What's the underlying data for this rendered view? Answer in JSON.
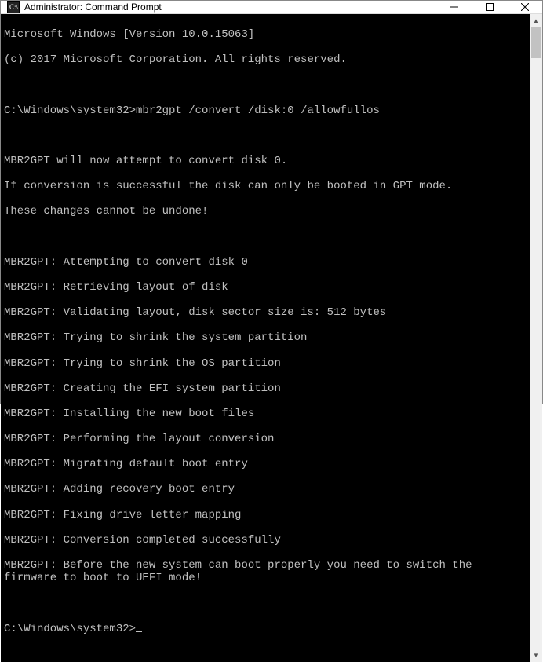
{
  "window": {
    "title": "Administrator: Command Prompt"
  },
  "console": {
    "header1": "Microsoft Windows [Version 10.0.15063]",
    "header2": "(c) 2017 Microsoft Corporation. All rights reserved.",
    "prompt1_path": "C:\\Windows\\system32>",
    "prompt1_cmd": "mbr2gpt /convert /disk:0 /allowfullos",
    "msg1": "MBR2GPT will now attempt to convert disk 0.",
    "msg2": "If conversion is successful the disk can only be booted in GPT mode.",
    "msg3": "These changes cannot be undone!",
    "log": [
      "MBR2GPT: Attempting to convert disk 0",
      "MBR2GPT: Retrieving layout of disk",
      "MBR2GPT: Validating layout, disk sector size is: 512 bytes",
      "MBR2GPT: Trying to shrink the system partition",
      "MBR2GPT: Trying to shrink the OS partition",
      "MBR2GPT: Creating the EFI system partition",
      "MBR2GPT: Installing the new boot files",
      "MBR2GPT: Performing the layout conversion",
      "MBR2GPT: Migrating default boot entry",
      "MBR2GPT: Adding recovery boot entry",
      "MBR2GPT: Fixing drive letter mapping",
      "MBR2GPT: Conversion completed successfully",
      "MBR2GPT: Before the new system can boot properly you need to switch the firmware to boot to UEFI mode!"
    ],
    "prompt2_path": "C:\\Windows\\system32>"
  }
}
